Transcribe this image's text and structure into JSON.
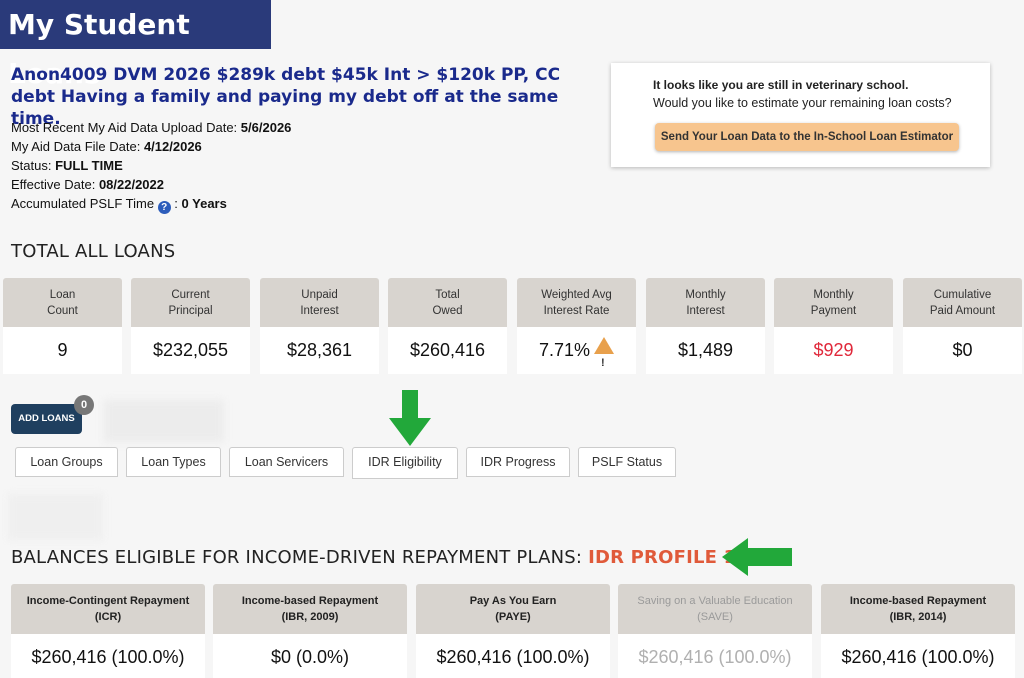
{
  "app": {
    "title": "My Student Loans"
  },
  "profile": {
    "headline": "Anon4009 DVM 2026 $289k debt $45k Int > $120k PP, CC debt Having a family and paying my debt off at the same time.",
    "upload_date_label": "Most Recent My Aid Data Upload Date:",
    "upload_date": "5/6/2026",
    "file_date_label": "My Aid Data File Date:",
    "file_date": "4/12/2026",
    "status_label": "Status:",
    "status": "FULL TIME",
    "effective_label": "Effective Date:",
    "effective_date": "08/22/2022",
    "pslf_label": "Accumulated PSLF Time",
    "pslf_value": "0 Years"
  },
  "promo": {
    "line1": "It looks like you are still in veterinary school.",
    "line2": "Would you like to estimate your remaining loan costs?",
    "button": "Send Your Loan Data to the In-School Loan Estimator"
  },
  "totals": {
    "title": "TOTAL ALL LOANS",
    "cards": [
      {
        "label_1": "Loan",
        "label_2": "Count",
        "value": "9"
      },
      {
        "label_1": "Current",
        "label_2": "Principal",
        "value": "$232,055"
      },
      {
        "label_1": "Unpaid",
        "label_2": "Interest",
        "value": "$28,361"
      },
      {
        "label_1": "Total",
        "label_2": "Owed",
        "value": "$260,416"
      },
      {
        "label_1": "Weighted Avg",
        "label_2": "Interest Rate",
        "value": "7.71%"
      },
      {
        "label_1": "Monthly",
        "label_2": "Interest",
        "value": "$1,489"
      },
      {
        "label_1": "Monthly",
        "label_2": "Payment",
        "value": "$929"
      },
      {
        "label_1": "Cumulative",
        "label_2": "Paid Amount",
        "value": "$0"
      }
    ]
  },
  "actions": {
    "add_loans": "ADD LOANS",
    "loan_badge": "0"
  },
  "tabs": [
    {
      "label": "Loan Groups"
    },
    {
      "label": "Loan Types"
    },
    {
      "label": "Loan Servicers"
    },
    {
      "label": "IDR Eligibility"
    },
    {
      "label": "IDR Progress"
    },
    {
      "label": "PSLF Status"
    }
  ],
  "idr": {
    "title": "BALANCES ELIGIBLE FOR INCOME-DRIVEN REPAYMENT PLANS:",
    "profile": "IDR PROFILE 1",
    "plans": [
      {
        "name": "Income-Contingent Repayment",
        "abbr": "(ICR)",
        "value": "$260,416 (100.0%)"
      },
      {
        "name": "Income-based Repayment",
        "abbr": "(IBR, 2009)",
        "value": "$0 (0.0%)"
      },
      {
        "name": "Pay As You Earn",
        "abbr": "(PAYE)",
        "value": "$260,416 (100.0%)"
      },
      {
        "name": "Saving on a Valuable Education",
        "abbr": "(SAVE)",
        "value": "$260,416 (100.0%)"
      },
      {
        "name": "Income-based Repayment",
        "abbr": "(IBR, 2014)",
        "value": "$260,416 (100.0%)"
      }
    ]
  },
  "colors": {
    "brand": "#2a3a7a",
    "accent": "#e05a3a",
    "payment": "#e0283a",
    "arrow": "#22a83a",
    "button": "#f7c58e"
  },
  "icons": {
    "help": "question-circle-icon",
    "warning": "warning-triangle-icon",
    "arrow_down": "arrow-down-icon",
    "arrow_left": "arrow-left-icon"
  }
}
